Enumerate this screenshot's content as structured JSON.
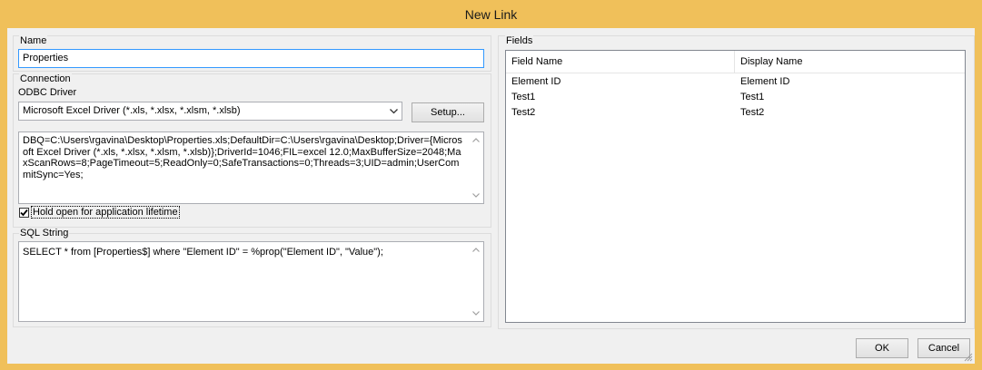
{
  "window": {
    "title": "New Link"
  },
  "name_section": {
    "label": "Name",
    "value": "Properties"
  },
  "connection": {
    "label": "Connection",
    "odbc_label": "ODBC Driver",
    "driver_value": "Microsoft Excel Driver (*.xls, *.xlsx, *.xlsm, *.xlsb)",
    "setup_label": "Setup...",
    "connection_string": "DBQ=C:\\Users\\rgavina\\Desktop\\Properties.xls;DefaultDir=C:\\Users\\rgavina\\Desktop;Driver={Microsoft Excel Driver (*.xls, *.xlsx, *.xlsm, *.xlsb)};DriverId=1046;FIL=excel 12.0;MaxBufferSize=2048;MaxScanRows=8;PageTimeout=5;ReadOnly=0;SafeTransactions=0;Threads=3;UID=admin;UserCommitSync=Yes;",
    "hold_open_label": "Hold open for application lifetime",
    "hold_open_checked": true
  },
  "sql": {
    "label": "SQL String",
    "value": "SELECT * from [Properties$] where \"Element ID\" = %prop(\"Element ID\", \"Value\");"
  },
  "fields": {
    "label": "Fields",
    "columns": [
      "Field Name",
      "Display Name"
    ],
    "rows": [
      {
        "field_name": "Element ID",
        "display_name": "Element ID"
      },
      {
        "field_name": "Test1",
        "display_name": "Test1"
      },
      {
        "field_name": "Test2",
        "display_name": "Test2"
      }
    ]
  },
  "buttons": {
    "ok": "OK",
    "cancel": "Cancel"
  },
  "colors": {
    "titlebar": "#f0c05a",
    "focus_border": "#3399ff"
  }
}
